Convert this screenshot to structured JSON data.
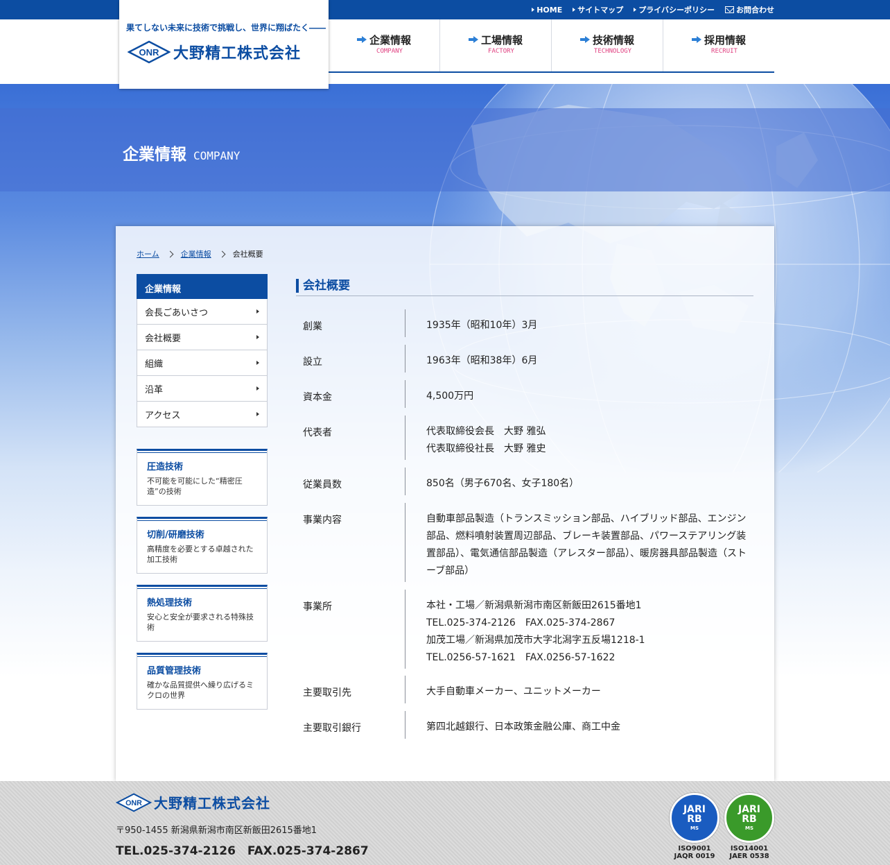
{
  "header": {
    "toplinks": [
      {
        "label": "HOME"
      },
      {
        "label": "サイトマップ"
      },
      {
        "label": "プライバシーポリシー"
      },
      {
        "label": "お問合わせ"
      }
    ],
    "tagline": "果てしない未来に技術で挑戦し、世界に翔ばたく――",
    "logo_mark": "ONR",
    "company_name": "大野精工株式会社",
    "nav": [
      {
        "jp": "企業情報",
        "en": "COMPANY"
      },
      {
        "jp": "工場情報",
        "en": "FACTORY"
      },
      {
        "jp": "技術情報",
        "en": "TECHNOLOGY"
      },
      {
        "jp": "採用情報",
        "en": "RECRUIT"
      }
    ]
  },
  "page_title": {
    "jp": "企業情報",
    "en": "COMPANY"
  },
  "breadcrumb": [
    "ホーム",
    "企業情報",
    "会社概要"
  ],
  "sidebar": {
    "heading": "企業情報",
    "items": [
      "会長ごあいさつ",
      "会社概要",
      "組織",
      "沿革",
      "アクセス"
    ],
    "cards": [
      {
        "title": "圧造技術",
        "desc": "不可能を可能にした“精密圧造”の技術"
      },
      {
        "title": "切削/研磨技術",
        "desc": "高精度を必要とする卓越された加工技術"
      },
      {
        "title": "熱処理技術",
        "desc": "安心と安全が要求される特殊技術"
      },
      {
        "title": "品質管理技術",
        "desc": "確かな品質提供へ繰り広げるミクロの世界"
      }
    ]
  },
  "content": {
    "heading": "会社概要",
    "rows": [
      {
        "label": "創業",
        "value": "1935年（昭和10年）3月"
      },
      {
        "label": "設立",
        "value": "1963年（昭和38年）6月"
      },
      {
        "label": "資本金",
        "value": "4,500万円"
      },
      {
        "label": "代表者",
        "value": "代表取締役会長　大野 雅弘\n代表取締役社長　大野 雅史"
      },
      {
        "label": "従業員数",
        "value": "850名（男子670名、女子180名）"
      },
      {
        "label": "事業内容",
        "value": "自動車部品製造（トランスミッション部品、ハイブリッド部品、エンジン部品、燃料噴射装置周辺部品、ブレーキ装置部品、パワーステアリング装置部品）、電気通信部品製造（アレスター部品）、暖房器具部品製造（ストーブ部品）"
      },
      {
        "label": "事業所",
        "value": "本社・工場／新潟県新潟市南区新飯田2615番地1\nTEL.025-374-2126　FAX.025-374-2867\n加茂工場／新潟県加茂市大字北潟字五反場1218-1\nTEL.0256-57-1621　FAX.0256-57-1622"
      },
      {
        "label": "主要取引先",
        "value": "大手自動車メーカー、ユニットメーカー"
      },
      {
        "label": "主要取引銀行",
        "value": "第四北越銀行、日本政策金融公庫、商工中金"
      }
    ]
  },
  "footer": {
    "company_name": "大野精工株式会社",
    "logo_mark": "ONR",
    "address": "〒950-1455 新潟県新潟市南区新飯田2615番地1",
    "tel": "TEL.025-374-2126　FAX.025-374-2867",
    "certs": [
      {
        "top": "JARI",
        "mid": "RB",
        "small": "MS",
        "label": "ISO9001\nJAQR 0019",
        "color": "#1a5cc0"
      },
      {
        "top": "JARI",
        "mid": "RB",
        "small": "MS",
        "label": "ISO14001\nJAER 0538",
        "color": "#3a9a2a"
      }
    ]
  }
}
